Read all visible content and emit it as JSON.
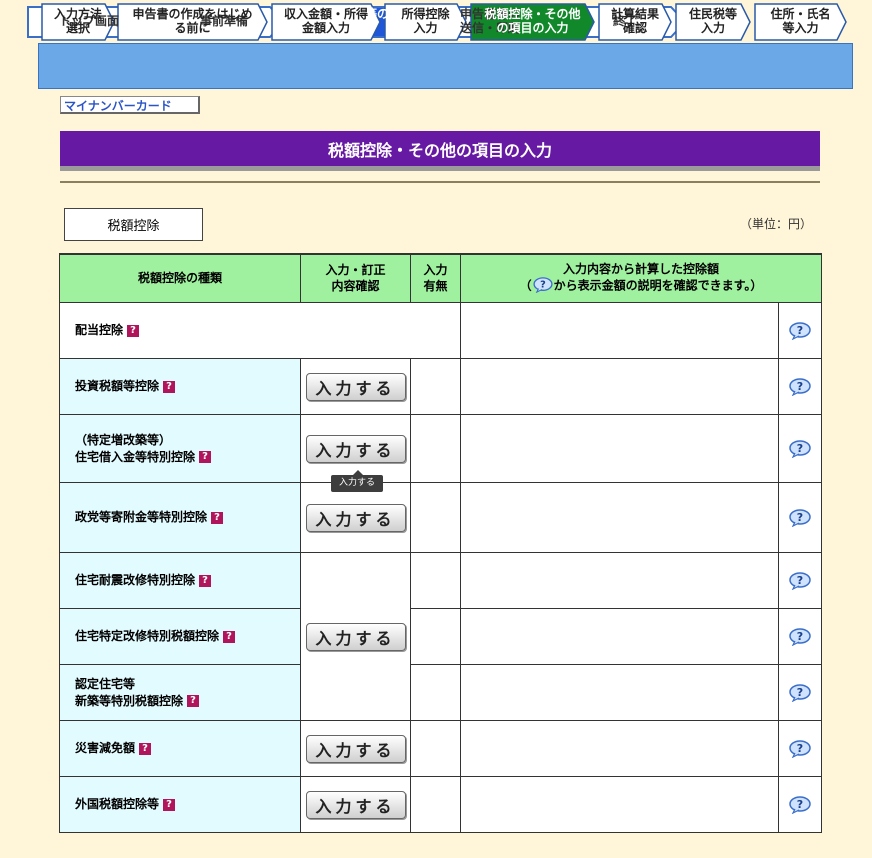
{
  "steps": [
    {
      "label": "トップ画面"
    },
    {
      "label": "事前準備"
    },
    {
      "label": "申告書等の\n作成"
    },
    {
      "label": "申告書等の\n送信・印刷"
    },
    {
      "label": "終了"
    }
  ],
  "substeps": [
    {
      "label": "入力方法\n選択"
    },
    {
      "label": "申告書の作成をはじめ\nる前に"
    },
    {
      "label": "収入金額・所得\n金額入力"
    },
    {
      "label": "所得控除\n入力"
    },
    {
      "label": "税額控除・その他\nの項目の入力"
    },
    {
      "label": "計算結果\n確認"
    },
    {
      "label": "住民税等\n入力"
    },
    {
      "label": "住所・氏名\n等入力"
    }
  ],
  "mynumber_link": "マイナンバーカード",
  "page_title": "税額控除・その他の項目の入力",
  "section_label": "税額控除",
  "unit_label": "（単位：円）",
  "table": {
    "headers": {
      "type": "税額控除の種類",
      "input": "入力・訂正\n内容確認",
      "present": "入力\n有無",
      "amount_line1": "入力内容から計算した控除額",
      "amount_line2_pre": "（",
      "amount_line2_post": "から表示金額の説明を確認できます。）"
    },
    "rows": [
      {
        "label": "配当控除"
      },
      {
        "label": "投資税額等控除"
      },
      {
        "label": "（特定増改築等）\n住宅借入金等特別控除"
      },
      {
        "label": "政党等寄附金等特別控除"
      },
      {
        "label": "住宅耐震改修特別控除"
      },
      {
        "label": "住宅特定改修特別税額控除"
      },
      {
        "label": "認定住宅等\n新築等特別税額控除"
      },
      {
        "label": "災害減免額"
      },
      {
        "label": "外国税額控除等"
      }
    ],
    "button_label": "入力する",
    "qmark": "?"
  },
  "tooltip": "入力する",
  "colors": {
    "title_bg": "#6619a3",
    "header_bg": "#9ff09f",
    "row_bg": "#e2fbff",
    "active_step": "#1f57d8",
    "active_substep": "#11892a",
    "qmark": "#b0155b"
  }
}
